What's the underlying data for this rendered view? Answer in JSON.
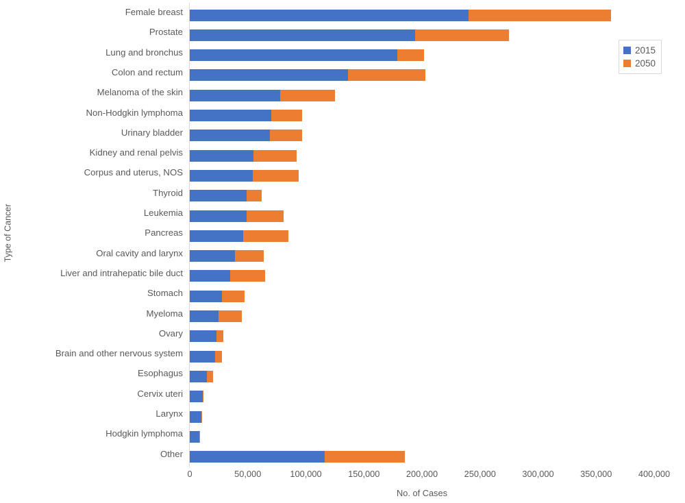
{
  "chart_data": {
    "type": "bar",
    "orientation": "horizontal",
    "stacked": true,
    "title": "",
    "xlabel": "No. of Cases",
    "ylabel": "Type of Cancer",
    "xlim": [
      0,
      400000
    ],
    "xticks": [
      0,
      50000,
      100000,
      150000,
      200000,
      250000,
      300000,
      350000,
      400000
    ],
    "xtick_labels": [
      "0",
      "50,000",
      "100,000",
      "150,000",
      "200,000",
      "250,000",
      "300,000",
      "350,000",
      "400,000"
    ],
    "grid": false,
    "legend_position": "top-right",
    "categories": [
      "Female breast",
      "Prostate",
      "Lung and bronchus",
      "Colon and rectum",
      "Melanoma of the skin",
      "Non-Hodgkin lymphoma",
      "Urinary bladder",
      "Kidney and renal pelvis",
      "Corpus and uterus, NOS",
      "Thyroid",
      "Leukemia",
      "Pancreas",
      "Oral cavity and larynx",
      "Liver and intrahepatic bile duct",
      "Stomach",
      "Myeloma",
      "Ovary",
      "Brain and other nervous system",
      "Esophagus",
      "Cervix uteri",
      "Larynx",
      "Hodgkin lymphoma",
      "Other"
    ],
    "series": [
      {
        "name": "2015",
        "color": "#4472C4",
        "values": [
          240000,
          194000,
          179000,
          136000,
          78000,
          70000,
          69000,
          55000,
          54000,
          49000,
          49000,
          46000,
          39000,
          35000,
          28000,
          25000,
          23000,
          22000,
          15000,
          11000,
          10000,
          8000,
          116000
        ]
      },
      {
        "name": "2050",
        "color": "#ED7D31",
        "values": [
          123000,
          81000,
          23000,
          67000,
          47000,
          27000,
          28000,
          37000,
          40000,
          13000,
          32000,
          39000,
          25000,
          30000,
          19000,
          20000,
          6000,
          6000,
          5000,
          1000,
          600,
          200,
          69000
        ]
      }
    ]
  },
  "legend": {
    "items": [
      {
        "label": "2015",
        "color": "#4472C4"
      },
      {
        "label": "2050",
        "color": "#ED7D31"
      }
    ]
  }
}
